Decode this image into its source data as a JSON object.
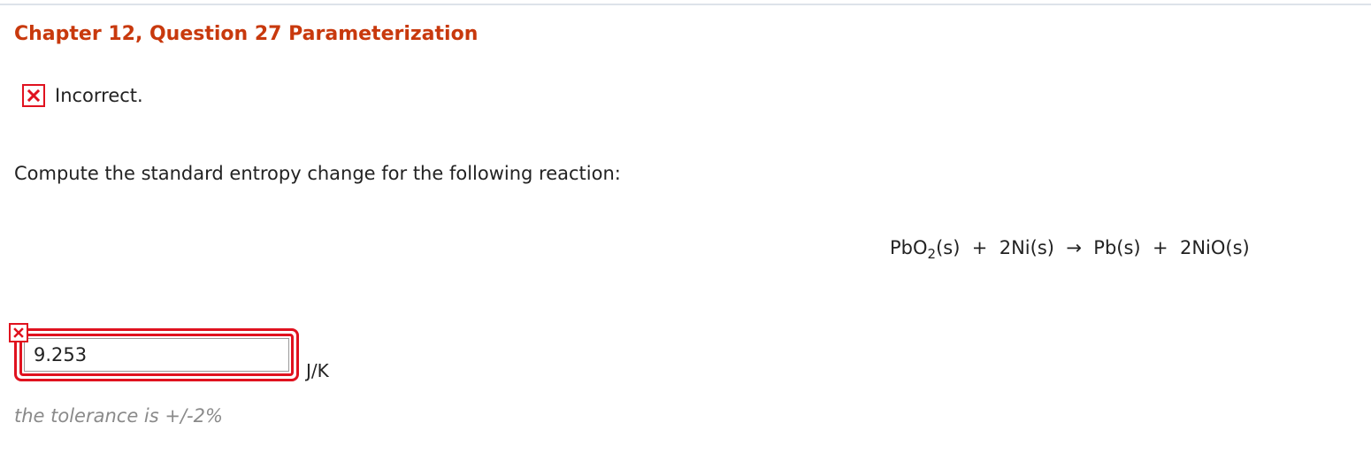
{
  "header": {
    "title": "Chapter 12, Question 27 Parameterization"
  },
  "status": {
    "icon": "x-mark-icon",
    "text": "Incorrect.",
    "color": "#e0121f"
  },
  "question": {
    "prompt": "Compute the standard entropy change for the following reaction:",
    "equation": {
      "reactant1_formula": "PbO",
      "reactant1_subscript": "2",
      "reactant1_state": "(s)",
      "plus1": "+",
      "reactant2": "2Ni(s)",
      "arrow": "→",
      "product1": "Pb(s)",
      "plus2": "+",
      "product2": "2NiO(s)"
    }
  },
  "answer": {
    "value": "9.253",
    "unit": "J/K",
    "status_icon": "x-mark-icon",
    "tolerance_text": "the tolerance is +/-2%"
  },
  "colors": {
    "title": "#c8390d",
    "error": "#e0121f",
    "muted": "#8a8a8a"
  }
}
